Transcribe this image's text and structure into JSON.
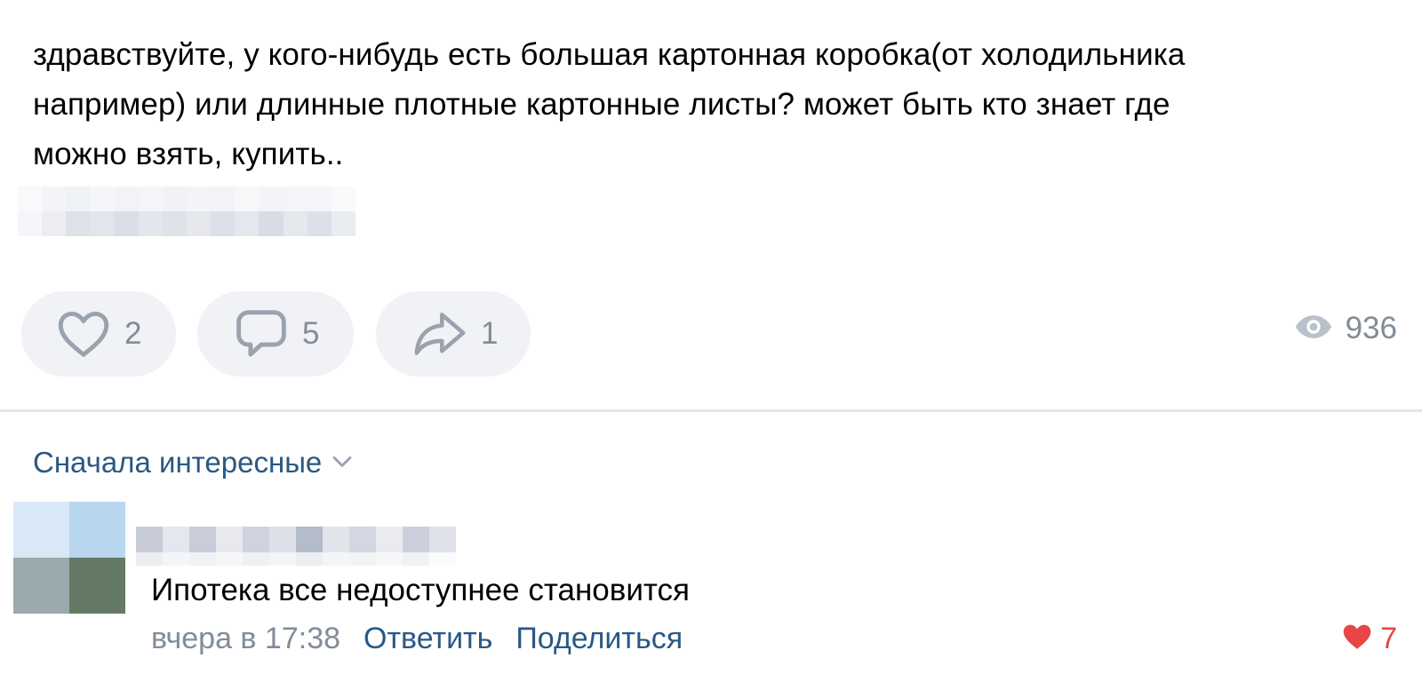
{
  "post": {
    "text": "здравствуйте, у кого-нибудь есть большая картонная коробка(от холодильника\nнапример) или длинные плотные картонные листы? может быть кто знает где\nможно взять, купить.."
  },
  "actions": {
    "like_count": "2",
    "comment_count": "5",
    "share_count": "1",
    "views_count": "936",
    "icons": [
      "heart-outline-icon",
      "comment-icon",
      "share-arrow-icon",
      "eye-icon"
    ]
  },
  "comments": {
    "sort_label": "Сначала интересные",
    "items": [
      {
        "text": "Ипотека все недоступнее становится",
        "date": "вчера в 17:38",
        "reply_label": "Ответить",
        "share_label": "Поделиться",
        "likes": "7"
      }
    ]
  },
  "colors": {
    "link": "#2a5885",
    "secondary_text": "#818c99",
    "button_bg": "#f0f2f5",
    "like_red": "#e64646",
    "divider": "#e3e5e8"
  }
}
